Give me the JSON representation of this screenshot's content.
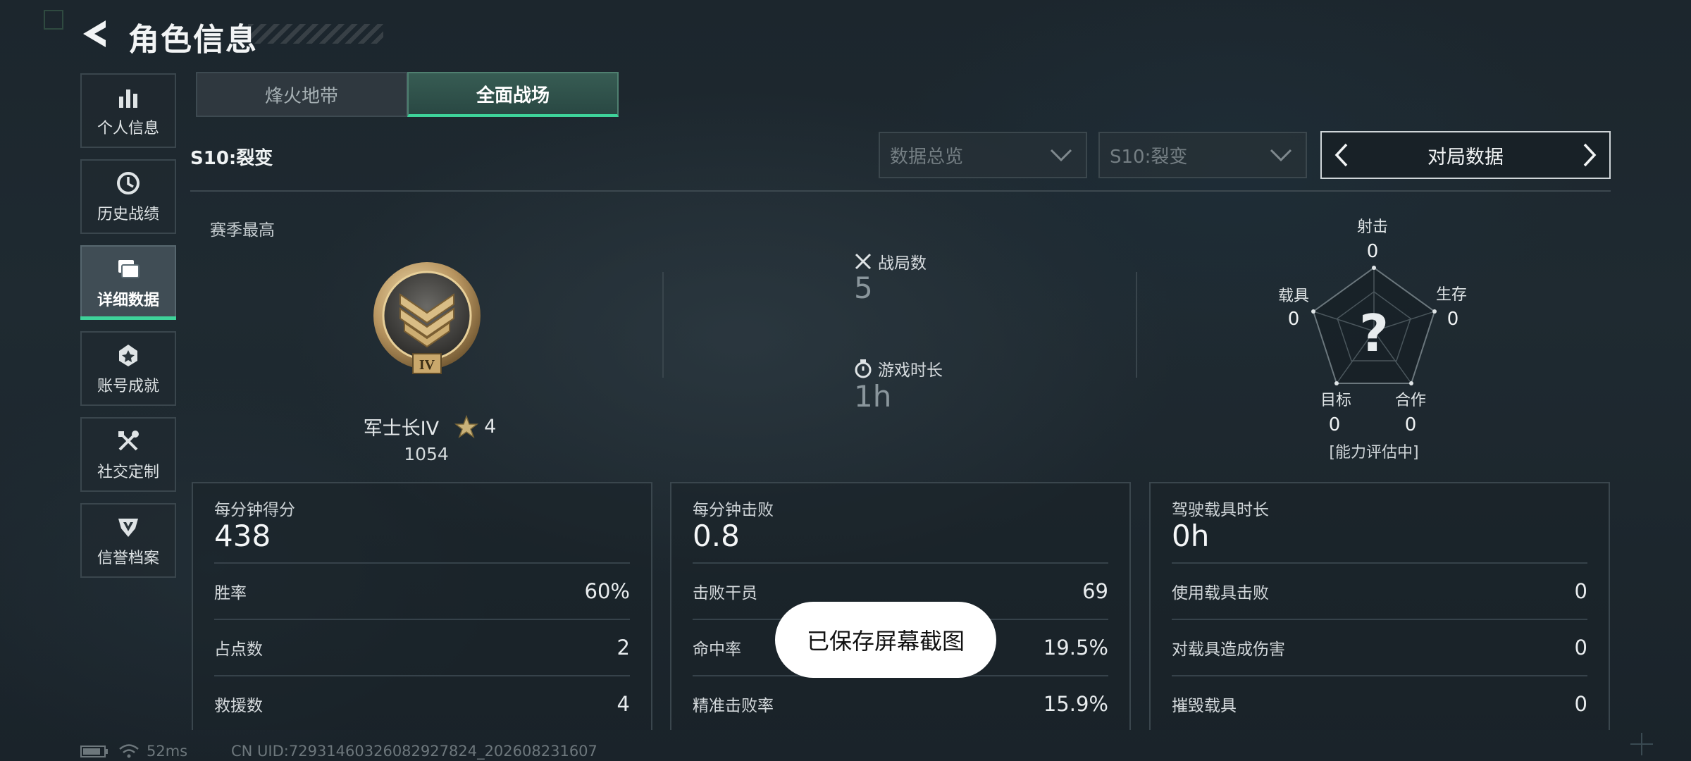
{
  "header": {
    "title": "角色信息",
    "back_icon": "back-arrow-icon"
  },
  "sidebar": {
    "items": [
      {
        "label": "个人信息",
        "icon": "bar-chart-icon",
        "active": false
      },
      {
        "label": "历史战绩",
        "icon": "history-clock-icon",
        "active": false
      },
      {
        "label": "详细数据",
        "icon": "folder-icon",
        "active": true
      },
      {
        "label": "账号成就",
        "icon": "achievement-badge-icon",
        "active": false
      },
      {
        "label": "社交定制",
        "icon": "tools-icon",
        "active": false
      },
      {
        "label": "信誉档案",
        "icon": "shield-emblem-icon",
        "active": false
      }
    ]
  },
  "tabs": [
    {
      "label": "烽火地带",
      "active": false
    },
    {
      "label": "全面战场",
      "active": true
    }
  ],
  "season": {
    "label": "S10:裂变"
  },
  "filters": {
    "overview": "数据总览",
    "season": "S10:裂变",
    "switcher": "对局数据"
  },
  "rank": {
    "section_label": "赛季最高",
    "name": "军士长IV",
    "stars": "4",
    "points": "1054",
    "badge_numeral": "IV"
  },
  "summary": {
    "matches_label": "战局数",
    "matches_value": "5",
    "time_label": "游戏时长",
    "time_value": "1h"
  },
  "radar": {
    "axes": [
      {
        "label": "射击",
        "value": "0"
      },
      {
        "label": "生存",
        "value": "0"
      },
      {
        "label": "合作",
        "value": "0"
      },
      {
        "label": "目标",
        "value": "0"
      },
      {
        "label": "载具",
        "value": "0"
      }
    ],
    "center": "?",
    "status": "[能力评估中]"
  },
  "cards": [
    {
      "head_label": "每分钟得分",
      "head_value": "438",
      "rows": [
        {
          "label": "胜率",
          "value": "60%"
        },
        {
          "label": "占点数",
          "value": "2"
        },
        {
          "label": "救援数",
          "value": "4"
        }
      ]
    },
    {
      "head_label": "每分钟击败",
      "head_value": "0.8",
      "rows": [
        {
          "label": "击败干员",
          "value": "69"
        },
        {
          "label": "命中率",
          "value": "19.5%"
        },
        {
          "label": "精准击败率",
          "value": "15.9%"
        }
      ]
    },
    {
      "head_label": "驾驶载具时长",
      "head_value": "0h",
      "rows": [
        {
          "label": "使用载具击败",
          "value": "0"
        },
        {
          "label": "对载具造成伤害",
          "value": "0"
        },
        {
          "label": "摧毁载具",
          "value": "0"
        }
      ]
    }
  ],
  "toast": "已保存屏幕截图",
  "status_bar": {
    "ping": "52ms",
    "uid": "CN UID:7293146032608292782​4_202608231607"
  },
  "colors": {
    "accent": "#3ed39a",
    "bg": "#1f2a31"
  }
}
